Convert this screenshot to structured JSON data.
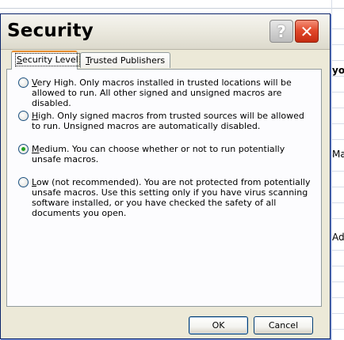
{
  "background_sheet": {
    "cell_fragments": [
      "you",
      "Ma",
      "Adv"
    ]
  },
  "dialog": {
    "title": "Security",
    "help_glyph": "?",
    "close_glyph": "✕",
    "tabs": [
      {
        "label_accel": "S",
        "label_rest": "ecurity Level",
        "selected": true
      },
      {
        "label_accel": "T",
        "label_rest": "rusted Publishers",
        "selected": false
      }
    ],
    "options": [
      {
        "accel": "V",
        "text": "ery High. Only macros installed in trusted locations will be allowed to run. All other signed and unsigned macros are disabled.",
        "checked": false
      },
      {
        "accel": "H",
        "text": "igh. Only signed macros from trusted sources will be allowed to run. Unsigned macros are automatically disabled.",
        "checked": false
      },
      {
        "accel": "M",
        "text": "edium. You can choose whether or not to run potentially unsafe macros.",
        "checked": true
      },
      {
        "accel": "L",
        "text": "ow (not recommended). You are not protected from potentially unsafe macros. Use this setting only if you have virus scanning software installed, or you have checked the safety of all documents you open.",
        "checked": false
      }
    ],
    "ok_label": "OK",
    "cancel_label": "Cancel"
  },
  "colors": {
    "dialog_face": "#ece9d8",
    "close_red": "#e24a2c",
    "selected_tab_accent": "#e68b2c",
    "radio_dot": "#21a121"
  }
}
